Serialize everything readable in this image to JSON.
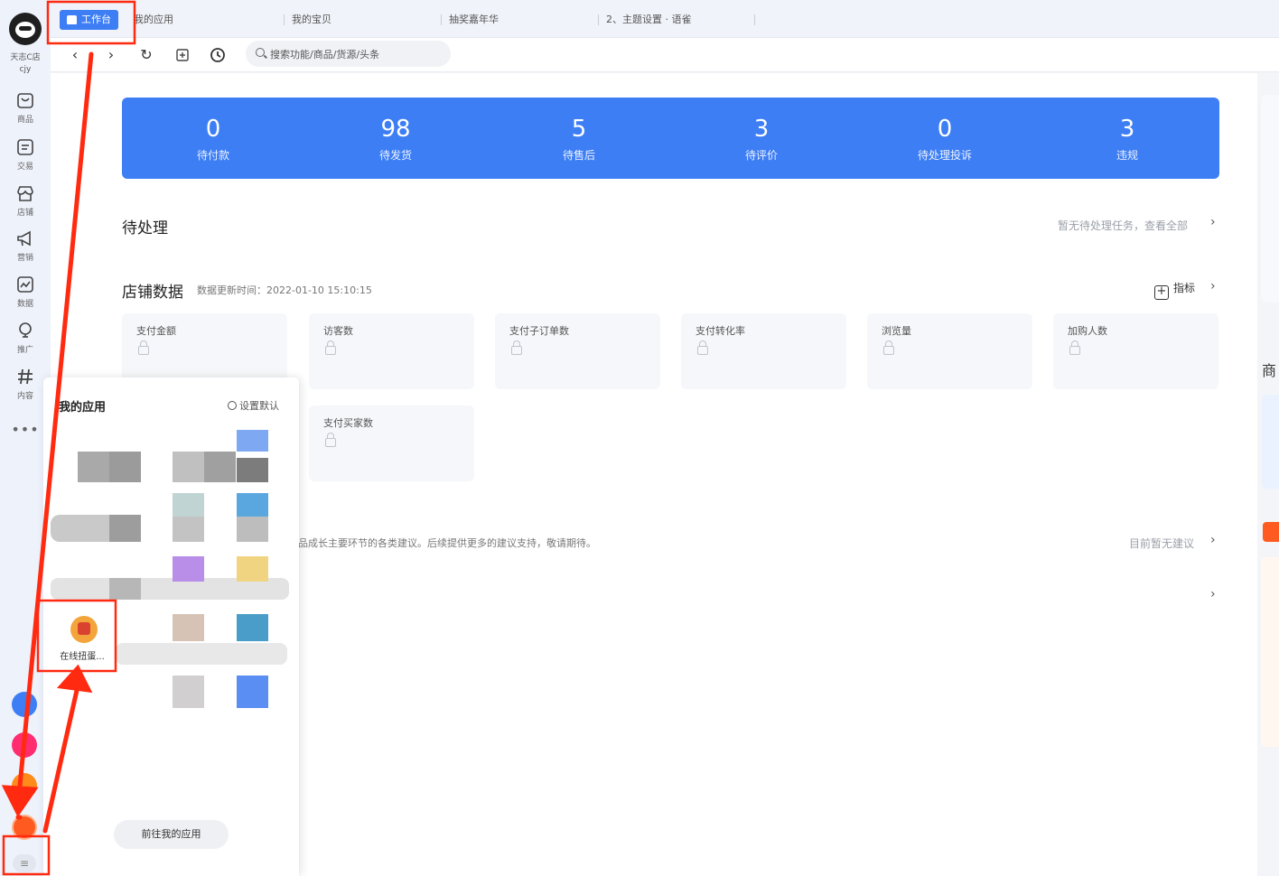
{
  "rail": {
    "shop_name": "天志C店",
    "user": "cjy",
    "items": [
      {
        "label": "商品",
        "icon": "bag-icon"
      },
      {
        "label": "交易",
        "icon": "document-icon"
      },
      {
        "label": "店铺",
        "icon": "store-icon"
      },
      {
        "label": "营销",
        "icon": "megaphone-icon"
      },
      {
        "label": "数据",
        "icon": "chart-icon"
      },
      {
        "label": "推广",
        "icon": "bulb-icon"
      },
      {
        "label": "内容",
        "icon": "hash-icon"
      }
    ],
    "more": "•••",
    "toggle": "≡"
  },
  "tabs": [
    {
      "label": "工作台",
      "active": true
    },
    {
      "label": "我的应用"
    },
    {
      "label": "我的宝贝"
    },
    {
      "label": "抽奖嘉年华"
    },
    {
      "label": "2、主题设置 · 语雀"
    }
  ],
  "toolbar": {
    "back": "‹",
    "forward": "›",
    "refresh": "↻",
    "search_placeholder": "搜索功能/商品/货源/头条"
  },
  "stats": [
    {
      "value": "0",
      "label": "待付款"
    },
    {
      "value": "98",
      "label": "待发货"
    },
    {
      "value": "5",
      "label": "待售后"
    },
    {
      "value": "3",
      "label": "待评价"
    },
    {
      "value": "0",
      "label": "待处理投诉"
    },
    {
      "value": "3",
      "label": "违规"
    }
  ],
  "pending": {
    "title": "待处理",
    "link": "暂无待处理任务，查看全部"
  },
  "shop_data": {
    "title": "店铺数据",
    "updated": "数据更新时间：2022-01-10 15:10:15",
    "indicator_label": "指标",
    "metrics": [
      "支付金额",
      "访客数",
      "支付子订单数",
      "支付转化率",
      "浏览量",
      "加购人数",
      "支付买家数"
    ]
  },
  "suggestions": {
    "text": "商品成长主要环节的各类建议。后续提供更多的建议支持，敬请期待。",
    "link": "目前暂无建议"
  },
  "right_edge": {
    "text": "商"
  },
  "apps_panel": {
    "title": "我的应用",
    "set_default": "设置默认",
    "featured_label": "在线扭蛋...",
    "goto_label": "前往我的应用"
  },
  "colors": {
    "accent": "#3d7ef5",
    "annotation": "#ff2a10"
  }
}
